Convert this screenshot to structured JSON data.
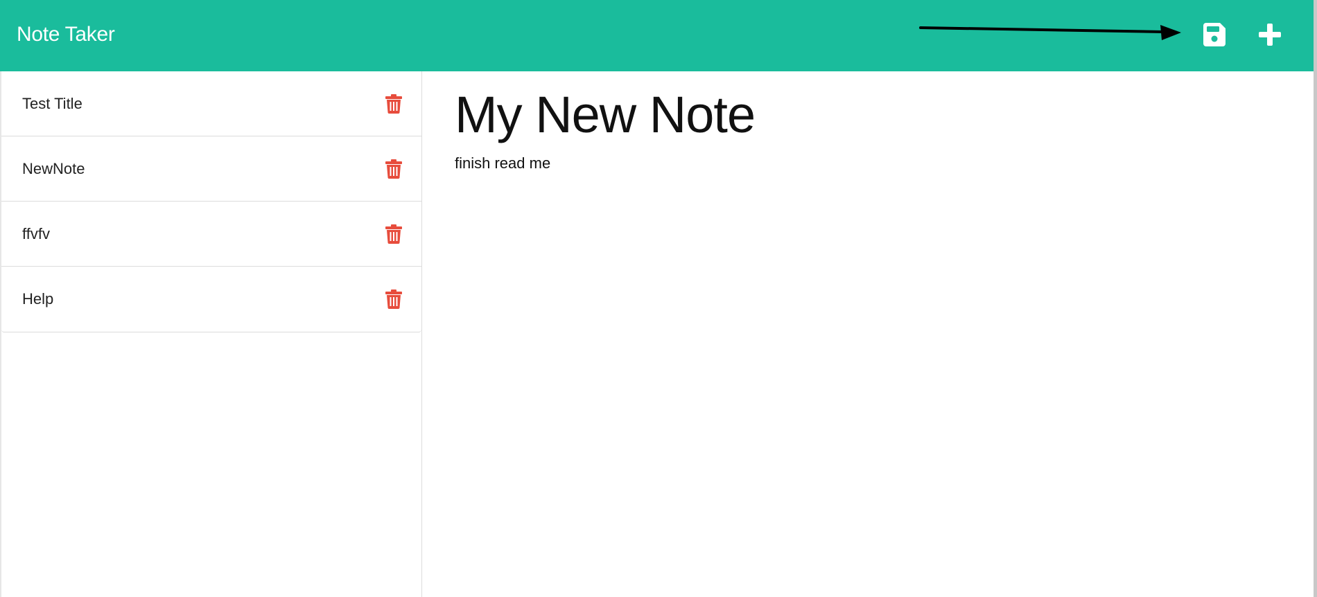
{
  "navbar": {
    "brand": "Note Taker",
    "background": "#1abc9c",
    "save_icon": "floppy-disk-icon",
    "new_icon": "plus-icon"
  },
  "annotation": {
    "icon": "arrow-right-icon",
    "color": "#000000"
  },
  "sidebar": {
    "delete_icon": "trash-icon",
    "delete_color": "#e74c3c",
    "notes": [
      {
        "title": "Test Title"
      },
      {
        "title": "NewNote"
      },
      {
        "title": "ffvfv"
      },
      {
        "title": "Help"
      }
    ]
  },
  "editor": {
    "title_value": "My New Note",
    "body_value": "finish read me"
  }
}
